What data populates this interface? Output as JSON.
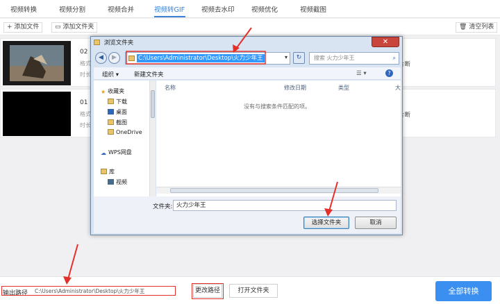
{
  "tabs": [
    {
      "label": "视频转换"
    },
    {
      "label": "视频分割"
    },
    {
      "label": "视频合并"
    },
    {
      "label": "视频转GIF"
    },
    {
      "label": "视频去水印"
    },
    {
      "label": "视频优化"
    },
    {
      "label": "视频截图"
    }
  ],
  "active_tab": "视频转GIF",
  "toolbar": {
    "add_file": "添加文件",
    "add_folder": "添加文件夹",
    "clear_list": "清空列表"
  },
  "files": [
    {
      "name": "02",
      "meta1": "格式",
      "meta2": "时长",
      "right_text": "片断"
    },
    {
      "name": "01",
      "meta1": "格式",
      "meta2": "时长",
      "right_text": "片断"
    }
  ],
  "bottom": {
    "output_label": "输出路径",
    "output_path": "C:\\Users\\Administrator\\Desktop\\火力少年王",
    "change_path": "更改路径",
    "open_folder": "打开文件夹",
    "convert_all": "全部转换"
  },
  "dialog": {
    "title": "浏览文件夹",
    "close": "✕",
    "address": "C:\\Users\\Administrator\\Desktop\\火力少年王",
    "search_placeholder": "搜索 火力少年王",
    "organize": "组织 ▾",
    "new_folder": "新建文件夹",
    "nav": [
      {
        "label": "收藏夹",
        "icon": "star-icon"
      },
      {
        "label": "下载",
        "icon": "download-folder-icon"
      },
      {
        "label": "桌面",
        "icon": "desktop-icon"
      },
      {
        "label": "截图",
        "icon": "folder-icon"
      },
      {
        "label": "OneDrive",
        "icon": "cloud-icon"
      },
      {
        "label": "WPS网盘",
        "icon": "wps-cloud-icon"
      },
      {
        "label": "库",
        "icon": "library-icon"
      },
      {
        "label": "视频",
        "icon": "video-library-icon"
      }
    ],
    "columns": [
      "名称",
      "修改日期",
      "类型",
      "大"
    ],
    "empty_message": "没有与搜索条件匹配的项。",
    "folder_label": "文件夹:",
    "folder_value": "火力少年王",
    "select_button": "选择文件夹",
    "cancel_button": "取消"
  },
  "colors": {
    "accent": "#3b82d6",
    "primary_button": "#3a8ff0",
    "annotation_red": "#e4302b"
  }
}
